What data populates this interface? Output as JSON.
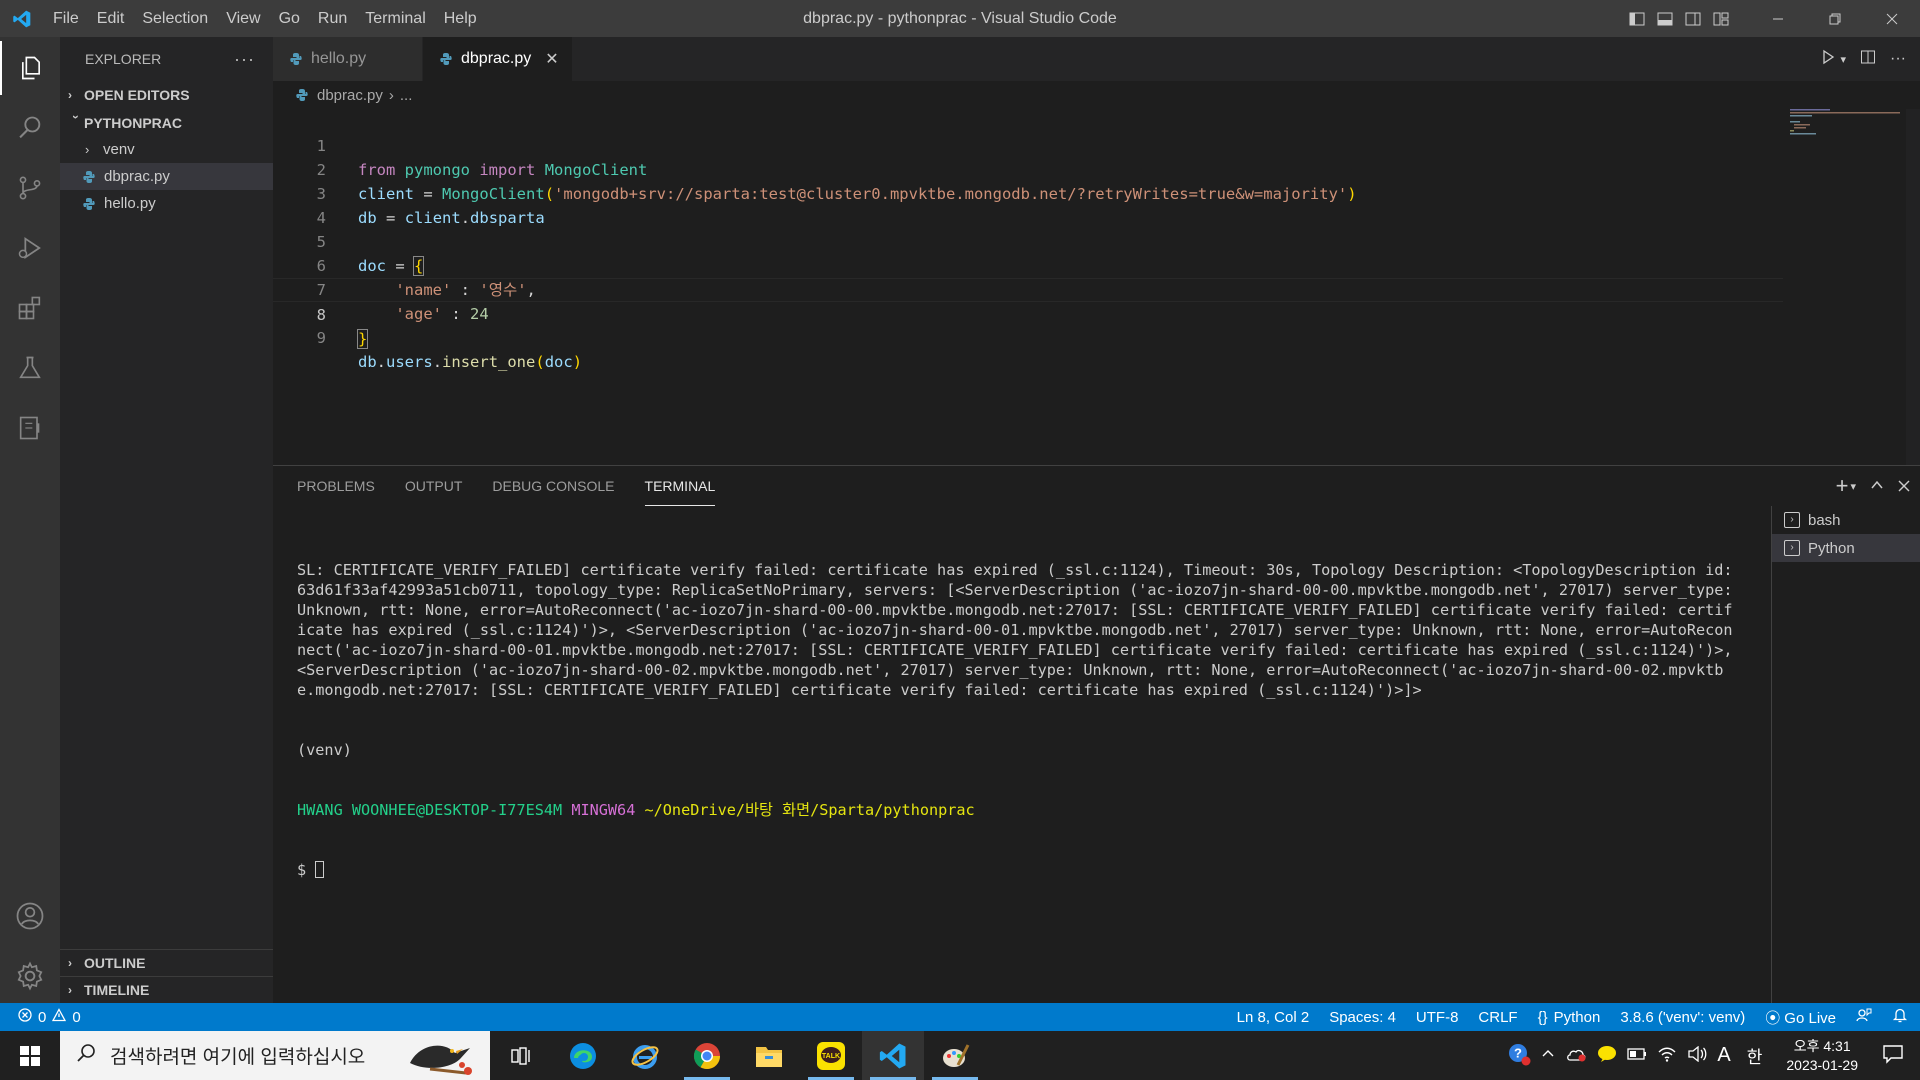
{
  "titlebar": {
    "menu": [
      "File",
      "Edit",
      "Selection",
      "View",
      "Go",
      "Run",
      "Terminal",
      "Help"
    ],
    "window_title": "dbprac.py - pythonprac - Visual Studio Code"
  },
  "sidebar": {
    "header": "EXPLORER",
    "open_editors": "OPEN EDITORS",
    "project": "PYTHONPRAC",
    "tree": [
      "venv",
      "dbprac.py",
      "hello.py"
    ],
    "outline": "OUTLINE",
    "timeline": "TIMELINE"
  },
  "tabs": [
    {
      "label": "hello.py"
    },
    {
      "label": "dbprac.py"
    }
  ],
  "breadcrumb": {
    "file": "dbprac.py",
    "more": "..."
  },
  "editor": {
    "line_numbers": [
      "1",
      "2",
      "3",
      "4",
      "5",
      "6",
      "7",
      "8",
      "9"
    ],
    "current_line": 8
  },
  "panel": {
    "tabs": [
      "PROBLEMS",
      "OUTPUT",
      "DEBUG CONSOLE",
      "TERMINAL"
    ],
    "terminal_output": "SL: CERTIFICATE_VERIFY_FAILED] certificate verify failed: certificate has expired (_ssl.c:1124), Timeout: 30s, Topology Description: <TopologyDescription id: 63d61f33af42993a51cb0711, topology_type: ReplicaSetNoPrimary, servers: [<ServerDescription ('ac-iozo7jn-shard-00-00.mpvktbe.mongodb.net', 27017) server_type: Unknown, rtt: None, error=AutoReconnect('ac-iozo7jn-shard-00-00.mpvktbe.mongodb.net:27017: [SSL: CERTIFICATE_VERIFY_FAILED] certificate verify failed: certificate has expired (_ssl.c:1124)')>, <ServerDescription ('ac-iozo7jn-shard-00-01.mpvktbe.mongodb.net', 27017) server_type: Unknown, rtt: None, error=AutoReconnect('ac-iozo7jn-shard-00-01.mpvktbe.mongodb.net:27017: [SSL: CERTIFICATE_VERIFY_FAILED] certificate verify failed: certificate has expired (_ssl.c:1124)')>, <ServerDescription ('ac-iozo7jn-shard-00-02.mpvktbe.mongodb.net', 27017) server_type: Unknown, rtt: None, error=AutoReconnect('ac-iozo7jn-shard-00-02.mpvktbe.mongodb.net:27017: [SSL: CERTIFICATE_VERIFY_FAILED] certificate verify failed: certificate has expired (_ssl.c:1124)')>]>",
    "venv": "(venv)",
    "prompt_user": "HWANG WOONHEE@DESKTOP-I77ES4M",
    "prompt_env": "MINGW64",
    "prompt_path": "~/OneDrive/바탕 화면/Sparta/pythonprac",
    "prompt_symbol": "$",
    "terminals": [
      "bash",
      "Python"
    ]
  },
  "statusbar": {
    "errors": "0",
    "warnings": "0",
    "position": "Ln 8, Col 2",
    "spaces": "Spaces: 4",
    "encoding": "UTF-8",
    "eol": "CRLF",
    "language": "Python",
    "interpreter": "3.8.6 ('venv': venv)",
    "golive": "Go Live"
  },
  "taskbar": {
    "search_placeholder": "검색하려면 여기에 입력하십시오",
    "ime": "한",
    "font_indicator": "A",
    "clock_time": "오후 4:31",
    "clock_date": "2023-01-29"
  },
  "colors": {
    "statusbar": "#007acc",
    "titlebar": "#3c3c3c",
    "activitybar": "#333333",
    "sidebar": "#252526",
    "editor": "#1e1e1e"
  }
}
